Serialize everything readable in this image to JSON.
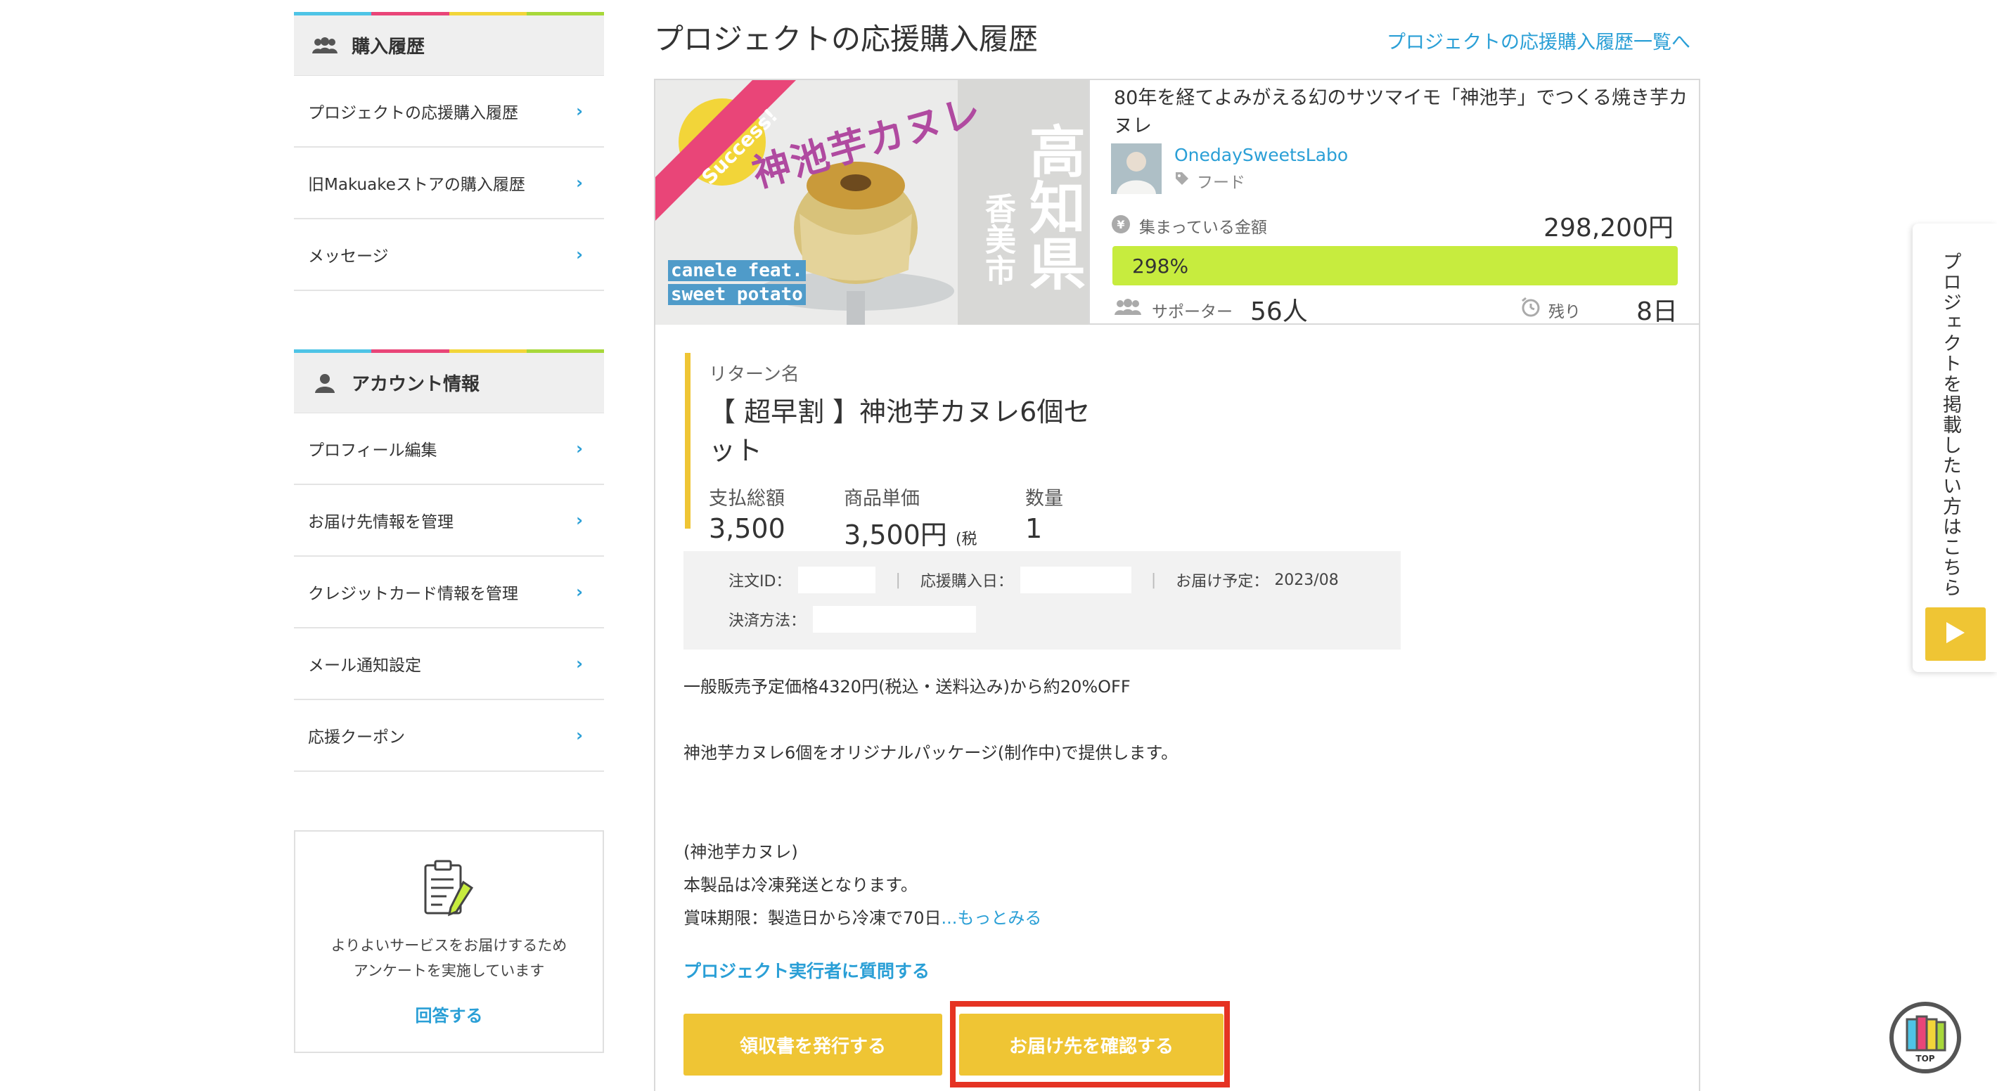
{
  "sidebar": {
    "colors": [
      "#4ec4e6",
      "#e94578",
      "#f2d539",
      "#a8d83a"
    ],
    "purchase_section": {
      "title": "購入履歴",
      "items": [
        {
          "label": "プロジェクトの応援購入履歴"
        },
        {
          "label": "旧Makuakeストアの購入履歴"
        },
        {
          "label": "メッセージ"
        }
      ]
    },
    "account_section": {
      "title": "アカウント情報",
      "items": [
        {
          "label": "プロフィール編集"
        },
        {
          "label": "お届け先情報を管理"
        },
        {
          "label": "クレジットカード情報を管理"
        },
        {
          "label": "メール通知設定"
        },
        {
          "label": "応援クーポン"
        }
      ]
    },
    "survey": {
      "line1": "よりよいサービスをお届けするため",
      "line2": "アンケートを実施しています",
      "link": "回答する"
    }
  },
  "main": {
    "title": "プロジェクトの応援購入履歴",
    "list_link": "プロジェクトの応援購入履歴一覧へ",
    "thumbnail": {
      "badge": "Success!",
      "headline": "神池芋カヌレ",
      "prefecture": "高知県",
      "city": "香美市",
      "sub1": "canele feat.",
      "sub2": "sweet potato"
    },
    "project": {
      "name": "80年を経てよみがえる幻のサツマイモ「神池芋」でつくる焼き芋カヌレ",
      "owner": "OnedaySweetsLabo",
      "category": "フード",
      "amount_label": "集まっている金額",
      "amount": "298,200円",
      "percent_text": "298%",
      "percent": 298,
      "supporters_label": "サポーター",
      "supporters": "56人",
      "remaining_label": "残り",
      "remaining": "8日"
    },
    "reward": {
      "label": "リターン名",
      "name": "【 超早割 】神池芋カヌレ6個セット",
      "total_label": "支払総額",
      "total": "3,500円",
      "unit_label": "商品単価",
      "unit": "3,500円",
      "tax_note": "(税込)",
      "qty_label": "数量",
      "qty": "1個"
    },
    "order": {
      "id_label": "注文ID：",
      "date_label": "応援購入日：",
      "delivery_label": "お届け予定：",
      "delivery": "2023/08",
      "payment_label": "決済方法："
    },
    "description": {
      "line1": "一般販売予定価格4320円(税込・送料込み)から約20%OFF",
      "line2": "神池芋カヌレ6個をオリジナルパッケージ(制作中)で提供します。",
      "line3": "(神池芋カヌレ)",
      "line4": "本製品は冷凍発送となります。",
      "line5": "賞味期限：製造日から冷凍で70日",
      "more": "...もっとみる"
    },
    "ask_link": "プロジェクト実行者に質問する",
    "buttons": {
      "receipt": "領収書を発行する",
      "confirm": "お届け先を確認する"
    },
    "accent": "#efc534",
    "highlight_color": "#e53323"
  },
  "float_tab": {
    "text": "プロジェクトを掲載したい方はこちら"
  },
  "top_button": {
    "label": "TOP"
  }
}
